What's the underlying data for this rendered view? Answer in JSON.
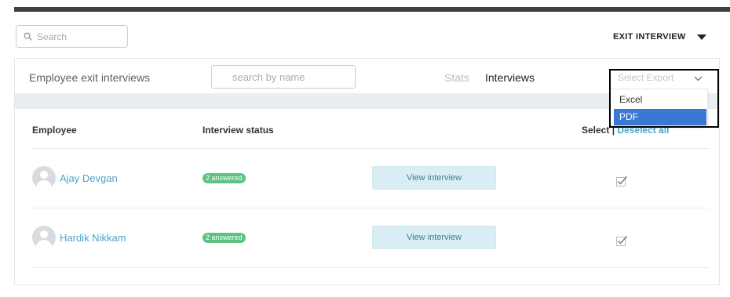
{
  "top_search": {
    "placeholder": "Search"
  },
  "header_menu": {
    "label": "EXIT INTERVIEW"
  },
  "panel": {
    "title": "Employee exit interviews",
    "name_search_placeholder": "search by name",
    "tabs": [
      {
        "label": "Stats",
        "active": false
      },
      {
        "label": "Interviews",
        "active": true
      }
    ],
    "export": {
      "placeholder": "Select Export",
      "options": [
        "Excel",
        "PDF"
      ],
      "highlighted": "PDF"
    }
  },
  "table": {
    "headers": {
      "employee": "Employee",
      "status": "Interview status",
      "select": "Select",
      "select_separator": "|",
      "deselect": "Deselect all"
    },
    "rows": [
      {
        "name": "Ajay Devgan",
        "status": "2 answered",
        "action": "View interview",
        "checked": true
      },
      {
        "name": "Hardik Nikkam",
        "status": "2 answered",
        "action": "View interview",
        "checked": true
      }
    ]
  },
  "colors": {
    "accent": "#4aa6c7",
    "badge": "#5cc383",
    "highlight": "#3a78d6",
    "top_bar": "#3a4045"
  }
}
